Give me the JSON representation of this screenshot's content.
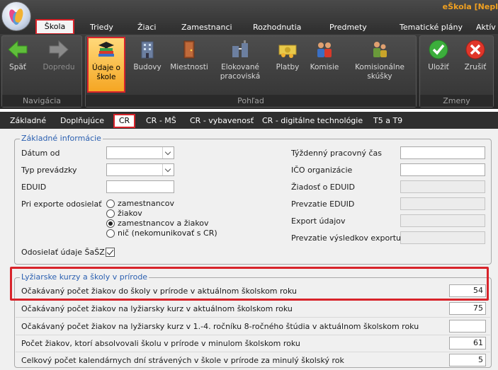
{
  "app": {
    "title": "eŠkola [Nepl"
  },
  "menu": {
    "items": [
      "Škola",
      "Triedy",
      "Žiaci",
      "Zamestnanci",
      "Rozhodnutia",
      "Predmety",
      "Tematické plány",
      "Aktív"
    ]
  },
  "ribbon": {
    "groups": {
      "navigacia": "Navigácia",
      "pohlad": "Pohľad",
      "zmeny": "Zmeny"
    },
    "buttons": {
      "spat": "Späť",
      "dopredu": "Dopredu",
      "udaje_line1": "Údaje o",
      "udaje_line2": "škole",
      "budovy": "Budovy",
      "miestnosti": "Miestnosti",
      "elokovane_line1": "Elokované",
      "elokovane_line2": "pracoviská",
      "platby": "Platby",
      "komisie": "Komisie",
      "komisionalne_line1": "Komisionálne",
      "komisionalne_line2": "skúšky",
      "ulozit": "Uložiť",
      "zrusit": "Zrušiť"
    }
  },
  "tabs": [
    "Základné",
    "Doplňujúce",
    "CR",
    "CR - MŠ",
    "CR - vybavenosť",
    "CR - digitálne technológie",
    "T5 a T9"
  ],
  "basic": {
    "legend": "Základné informácie",
    "datum_od": "Dátum od",
    "typ_prevadzky": "Typ prevádzky",
    "eduid": "EDUID",
    "pri_exporte": "Pri exporte odosielať",
    "radio_options": [
      "zamestnancov",
      "žiakov",
      "zamestnancov a žiakov",
      "nič (nekomunikovať s CR)"
    ],
    "selected_radio": "zamestnancov a žiakov",
    "odosielat": "Odosielať údaje ŠaŠZ",
    "tyzdenny": "Týždenný pracovný čas",
    "ico": "IČO organizácie",
    "ziadost": "Žiadosť o EDUID",
    "prevzatie_eduid": "Prevzatie EDUID",
    "export_udajov": "Export údajov",
    "prevzatie_vysledkov": "Prevzatie výsledkov exportu"
  },
  "ski": {
    "legend": "Lyžiarske kurzy a školy v prírode",
    "rows": [
      {
        "label": "Očakávaný počet žiakov do školy v prírode v aktuálnom školskom roku",
        "value": "54"
      },
      {
        "label": "Očakávaný počet žiakov na lyžiarsky kurz v aktuálnom školskom roku",
        "value": "75"
      },
      {
        "label": "Očakávaný počet žiakov na lyžiarsky kurz v 1.-4. ročníku 8-ročného štúdia v aktuálnom školskom roku",
        "value": ""
      },
      {
        "label": "Počet žiakov, ktorí absolvovali školu v prírode v minulom školskom roku",
        "value": "61"
      },
      {
        "label": "Celkový počet kalendárnych dní strávených v škole v prírode za minulý školský rok",
        "value": "5"
      }
    ]
  },
  "colors": {
    "accent_red": "#d8232a",
    "legend_blue": "#2a5fb0",
    "title_orange": "#f0a020"
  }
}
